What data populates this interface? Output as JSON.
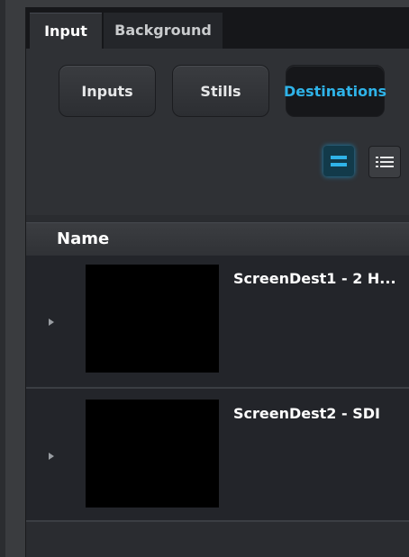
{
  "tabs": [
    {
      "label": "Input",
      "active": true
    },
    {
      "label": "Background",
      "active": false
    }
  ],
  "mode_buttons": [
    {
      "label": "Inputs",
      "selected": false
    },
    {
      "label": "Stills",
      "selected": false
    },
    {
      "label": "Destinations",
      "selected": true
    }
  ],
  "view_toggle": {
    "thumbnail_icon": "thumbnail-view-icon",
    "list_icon": "list-view-icon",
    "active": "thumbnail"
  },
  "table": {
    "header": "Name",
    "rows": [
      {
        "name": "ScreenDest1 - 2 H..."
      },
      {
        "name": "ScreenDest2 - SDI"
      }
    ]
  },
  "colors": {
    "accent": "#2fb3e8",
    "panel": "#2a2c30",
    "thumbnail": "#000000"
  }
}
